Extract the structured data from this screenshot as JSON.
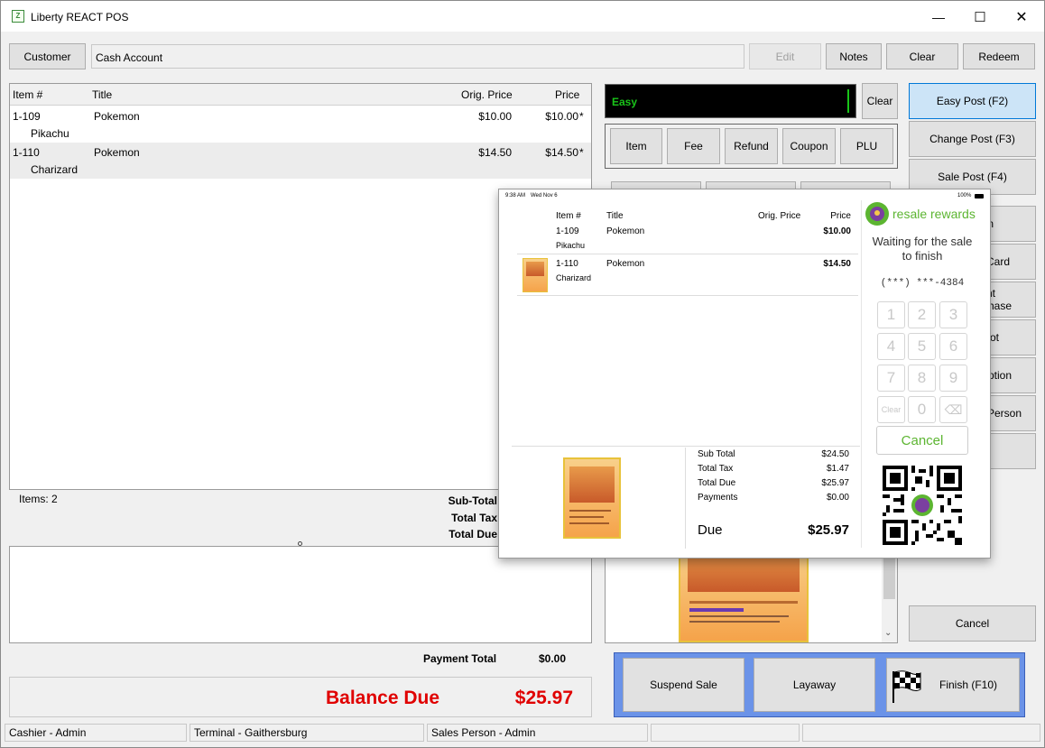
{
  "window": {
    "title": "Liberty REACT POS",
    "controls": {
      "minimize": "—",
      "maximize": "☐",
      "close": "✕"
    }
  },
  "top_bar": {
    "customer_label": "Customer",
    "account_value": "Cash Account",
    "edit_label": "Edit",
    "notes_label": "Notes",
    "clear_label": "Clear",
    "redeem_label": "Redeem"
  },
  "item_grid": {
    "headers": {
      "item": "Item #",
      "title": "Title",
      "orig_price": "Orig. Price",
      "price": "Price"
    },
    "rows": [
      {
        "item": "1-109",
        "title": "Pokemon",
        "subtitle": "Pikachu",
        "orig_price": "$10.00",
        "price": "$10.00",
        "flag": "*"
      },
      {
        "item": "1-110",
        "title": "Pokemon",
        "subtitle": "Charizard",
        "orig_price": "$14.50",
        "price": "$14.50",
        "flag": "*"
      }
    ]
  },
  "totals": {
    "items_count": "Items: 2",
    "subtotal_label": "Sub-Total",
    "tax_label": "Total Tax",
    "due_label": "Total Due",
    "payment_total_label": "Payment Total",
    "payment_total_value": "$0.00",
    "balance_due_label": "Balance Due",
    "balance_due_value": "$25.97"
  },
  "entry": {
    "input_value": "Easy",
    "clear_label": "Clear",
    "item_label": "Item",
    "fee_label": "Fee",
    "refund_label": "Refund",
    "coupon_label": "Coupon",
    "plu_label": "PLU"
  },
  "side_buttons": {
    "easy_post": "Easy Post (F2)",
    "change_post": "Change Post (F3)",
    "sale_post": "Sale Post (F4)",
    "partial_1": "n",
    "partial_2": "Card",
    "partial_3a": "nt",
    "partial_3b": "hase",
    "partial_4": "ot",
    "partial_5": "ption",
    "partial_6": "Person",
    "cancel": "Cancel"
  },
  "bottom_actions": {
    "suspend": "Suspend Sale",
    "layaway": "Layaway",
    "finish": "Finish (F10)"
  },
  "status_bar": {
    "cashier": "Cashier - Admin",
    "terminal": "Terminal - Gaithersburg",
    "sales_person": "Sales Person - Admin"
  },
  "customer_display": {
    "status_time": "9:38 AM",
    "status_date": "Wed Nov 6",
    "battery": "100%",
    "headers": {
      "item": "Item #",
      "title": "Title",
      "orig_price": "Orig. Price",
      "price": "Price"
    },
    "rows": [
      {
        "item": "1-109",
        "title": "Pokemon",
        "subtitle": "Pikachu",
        "price": "$10.00"
      },
      {
        "item": "1-110",
        "title": "Pokemon",
        "subtitle": "Charizard",
        "price": "$14.50"
      }
    ],
    "summary": {
      "subtotal_label": "Sub Total",
      "subtotal_value": "$24.50",
      "tax_label": "Total Tax",
      "tax_value": "$1.47",
      "due_label": "Total Due",
      "due_value": "$25.97",
      "payments_label": "Payments",
      "payments_value": "$0.00",
      "big_due_label": "Due",
      "big_due_value": "$25.97"
    },
    "rewards_brand": "resale rewards",
    "waiting_text_1": "Waiting for the sale",
    "waiting_text_2": "to finish",
    "phone": "(***) ***-4384",
    "keys": [
      "1",
      "2",
      "3",
      "4",
      "5",
      "6",
      "7",
      "8",
      "9",
      "Clear",
      "0",
      "⌫"
    ],
    "cancel_label": "Cancel"
  },
  "colors": {
    "balance_red": "#e00000",
    "entry_green": "#19c419",
    "rewards_green": "#5cb531",
    "rewards_purple": "#7b3fa0",
    "highlight_blue": "#cce4f7",
    "action_blue": "#4f7fe0"
  }
}
